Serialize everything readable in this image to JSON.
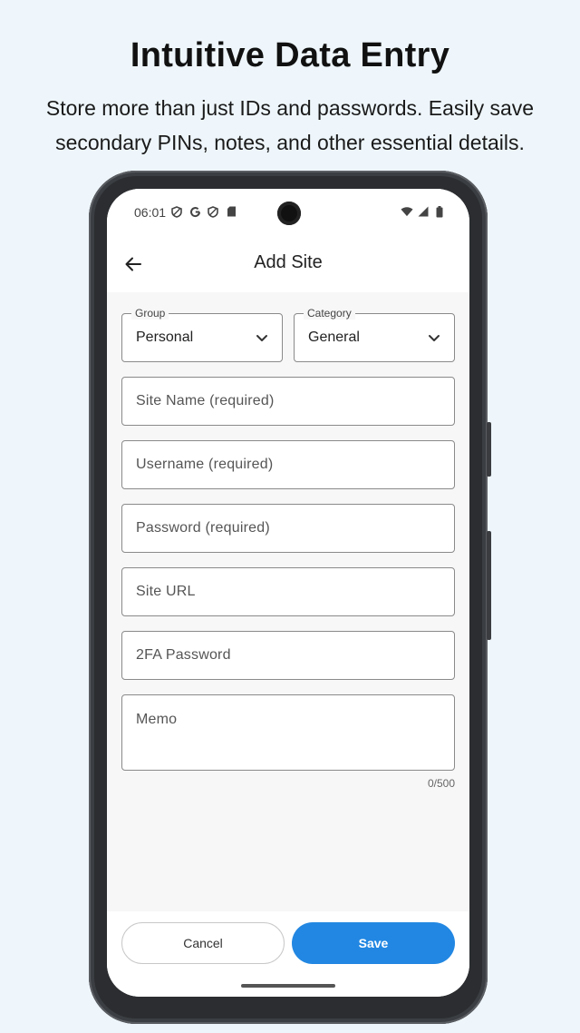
{
  "promo": {
    "headline": "Intuitive Data Entry",
    "subline": "Store more than just IDs and passwords. Easily save secondary PINs, notes, and other essential details."
  },
  "statusbar": {
    "time": "06:01",
    "icons_left": [
      "shield-icon",
      "google-icon",
      "shield-icon",
      "sdcard-icon"
    ],
    "icons_right": [
      "wifi-icon",
      "signal-icon",
      "battery-icon"
    ]
  },
  "appbar": {
    "back_icon": "arrow-left-icon",
    "title": "Add Site"
  },
  "form": {
    "group": {
      "label": "Group",
      "value": "Personal"
    },
    "category": {
      "label": "Category",
      "value": "General"
    },
    "site_name_placeholder": "Site Name (required)",
    "username_placeholder": "Username (required)",
    "password_placeholder": "Password (required)",
    "site_url_placeholder": "Site URL",
    "twofa_placeholder": "2FA Password",
    "memo_placeholder": "Memo",
    "memo_counter": "0/500"
  },
  "actions": {
    "cancel_label": "Cancel",
    "save_label": "Save"
  },
  "colors": {
    "accent": "#2287e2",
    "background": "#eef6fb"
  }
}
